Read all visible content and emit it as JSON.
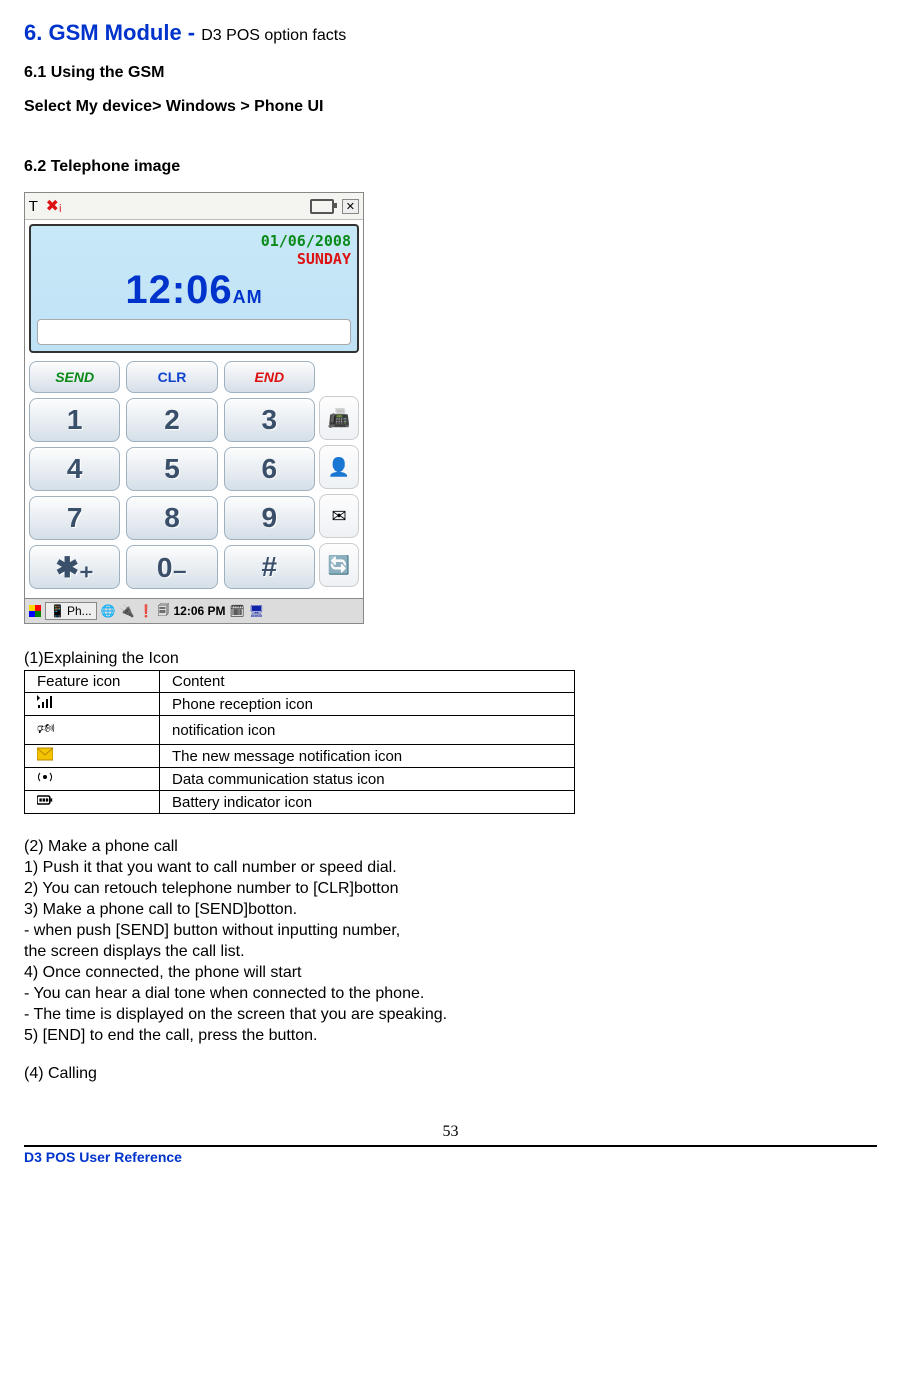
{
  "heading": {
    "main": "6. GSM Module",
    "dash": " - ",
    "sub": "D3 POS option facts"
  },
  "s61": {
    "title": "6.1 Using the GSM",
    "instr": "Select My device> Windows > Phone UI"
  },
  "s62": {
    "title": "6.2 Telephone image"
  },
  "phone": {
    "date": "01/06/2008",
    "day": "SUNDAY",
    "time": "12:06",
    "ampm": "AM",
    "ctl": {
      "send": "SEND",
      "clr": "CLR",
      "end": "END"
    },
    "pad": [
      "1",
      "2",
      "3",
      "4",
      "5",
      "6",
      "7",
      "8",
      "9",
      "✱₊",
      "0₋",
      "#"
    ],
    "sideicons": [
      "phone-settings",
      "contacts",
      "message",
      "sync"
    ],
    "taskbar": {
      "app": "Ph...",
      "clock": "12:06 PM"
    }
  },
  "iconTable": {
    "caption": "(1)Explaining the Icon",
    "head": [
      "Feature icon",
      "Content"
    ],
    "rows": [
      {
        "iconName": "signal-icon",
        "content": "Phone reception icon"
      },
      {
        "iconName": "bell-icon",
        "content": "notification icon"
      },
      {
        "iconName": "mail-icon",
        "content": "The new message notification icon"
      },
      {
        "iconName": "data-icon",
        "content": "Data communication status icon"
      },
      {
        "iconName": "battery-icon",
        "content": "Battery indicator icon"
      }
    ]
  },
  "s2": {
    "title": "(2) Make a phone call",
    "l1": "1) Push it that you want to call number or speed dial.",
    "l2": "2) You can retouch telephone number to [CLR]botton",
    "l3": "3) Make a phone call to [SEND]botton.",
    "l3a": "- when push [SEND] button without inputting number,",
    "l3b": "the screen displays the call list.",
    "l4": "4) Once connected, the phone will start",
    "l4a": "- You can hear a dial tone when connected to the phone.",
    "l4b": "- The time is displayed on the screen that you are speaking.",
    "l5": "5) [END] to end the call, press the button."
  },
  "s4": {
    "title": "(4) Calling"
  },
  "page": "53",
  "footerText": "D3 POS User Reference"
}
